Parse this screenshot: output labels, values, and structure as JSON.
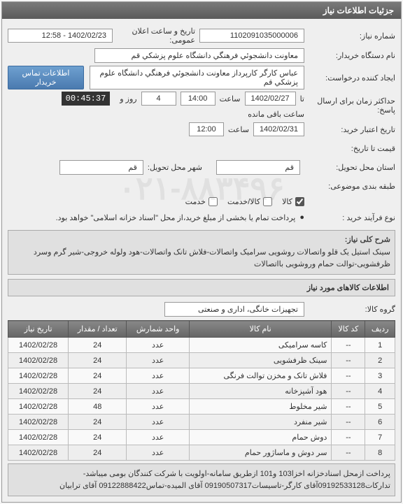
{
  "panel_title": "جزئیات اطلاعات نیاز",
  "fields": {
    "number_label": "شماره نیاز:",
    "number_value": "1102091035000006",
    "announce_label": "تاریخ و ساعت اعلان عمومی:",
    "announce_value": "1402/02/23 - 12:58",
    "buyer_label": "نام دستگاه خریدار:",
    "buyer_value": "معاونت دانشجوئي فرهنگي دانشگاه علوم پزشكي قم",
    "creator_label": "ایجاد کننده درخواست:",
    "creator_value": "عباس کارگر کارپرداز معاونت دانشجوئي فرهنگي دانشگاه علوم پزشكي قم",
    "contact_btn": "اطلاعات تماس خریدار",
    "deadline_label": "حداکثر زمان برای ارسال پاسخ:",
    "deadline_answer": "تا",
    "deadline_date": "1402/02/27",
    "time_label": "ساعت",
    "deadline_time": "14:00",
    "day_label": "روز و",
    "day_count": "4",
    "remain_label": "ساعت باقی مانده",
    "remain_time": "00:45:37",
    "validity_label": "تاریخ اعتبار خرید:",
    "validity_date": "1402/02/31",
    "validity_time": "12:00",
    "price_until_label": "قیمت تا تاریخ:",
    "province_label": "استان محل تحویل:",
    "province_value": "قم",
    "city_label": "شهر محل تحویل:",
    "city_value": "قم",
    "category_label": "طبقه بندی موضوعی:",
    "cat_goods": "کالا",
    "cat_service": "کالا/خدمت",
    "cat_srv": "خدمت",
    "process_label": "نوع فرآیند خرید :",
    "process_value": "●",
    "process_note": "پرداخت تمام یا بخشی از مبلغ خرید،از محل \"اسناد خزانه اسلامی\" خواهد بود.",
    "summary_label": "شرح کلی نیاز:",
    "summary_text": "سینک استیل یک قلو واتصالات روشویی سرامیک واتصالات-فلاش تانک واتصالات-هود ولوله خروجی-شیر گرم وسرد ظرفشویی-توالت حمام  وروشویی بااتصالات",
    "items_title": "اطلاعات کالاهای مورد نیاز",
    "group_label": "گروه کالا:",
    "group_value": "تجهیزات خانگی، اداری و صنعتی"
  },
  "table": {
    "headers": [
      "ردیف",
      "کد کالا",
      "نام کالا",
      "واحد شمارش",
      "تعداد / مقدار",
      "تاریخ نیاز"
    ],
    "rows": [
      {
        "n": "1",
        "code": "--",
        "name": "کاسه سرامیکی",
        "unit": "عدد",
        "qty": "24",
        "date": "1402/02/28"
      },
      {
        "n": "2",
        "code": "--",
        "name": "سینک ظرفشویی",
        "unit": "عدد",
        "qty": "24",
        "date": "1402/02/28"
      },
      {
        "n": "3",
        "code": "--",
        "name": "فلاش تانک و مخزن توالت فرنگی",
        "unit": "عدد",
        "qty": "24",
        "date": "1402/02/28"
      },
      {
        "n": "4",
        "code": "--",
        "name": "هود آشپزخانه",
        "unit": "عدد",
        "qty": "24",
        "date": "1402/02/28"
      },
      {
        "n": "5",
        "code": "--",
        "name": "شیر مخلوط",
        "unit": "عدد",
        "qty": "48",
        "date": "1402/02/28"
      },
      {
        "n": "6",
        "code": "--",
        "name": "شیر منفرد",
        "unit": "عدد",
        "qty": "24",
        "date": "1402/02/28"
      },
      {
        "n": "7",
        "code": "--",
        "name": "دوش حمام",
        "unit": "عدد",
        "qty": "24",
        "date": "1402/02/28"
      },
      {
        "n": "8",
        "code": "--",
        "name": "سر دوش و ماساژور حمام",
        "unit": "عدد",
        "qty": "24",
        "date": "1402/02/28"
      }
    ]
  },
  "footer": "پرداخت ازمحل اسنادخزانه اخزا103 و101 ازطریق سامانه-اولویت با شرکت کنندگان بومی میباشد-تدارکات09192533128آقای کارگر-تاسیسات09190507317 آقای المیده-تماس09122888422 آقای ترابیان",
  "watermark": "۰۲۱-۸۸۳۴۹۶"
}
